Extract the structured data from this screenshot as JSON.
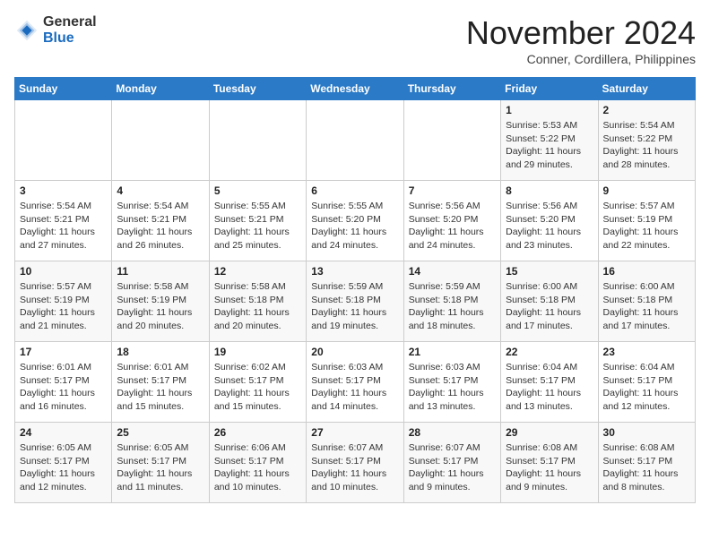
{
  "header": {
    "logo_general": "General",
    "logo_blue": "Blue",
    "month": "November 2024",
    "location": "Conner, Cordillera, Philippines"
  },
  "weekdays": [
    "Sunday",
    "Monday",
    "Tuesday",
    "Wednesday",
    "Thursday",
    "Friday",
    "Saturday"
  ],
  "weeks": [
    [
      {
        "day": "",
        "info": ""
      },
      {
        "day": "",
        "info": ""
      },
      {
        "day": "",
        "info": ""
      },
      {
        "day": "",
        "info": ""
      },
      {
        "day": "",
        "info": ""
      },
      {
        "day": "1",
        "info": "Sunrise: 5:53 AM\nSunset: 5:22 PM\nDaylight: 11 hours\nand 29 minutes."
      },
      {
        "day": "2",
        "info": "Sunrise: 5:54 AM\nSunset: 5:22 PM\nDaylight: 11 hours\nand 28 minutes."
      }
    ],
    [
      {
        "day": "3",
        "info": "Sunrise: 5:54 AM\nSunset: 5:21 PM\nDaylight: 11 hours\nand 27 minutes."
      },
      {
        "day": "4",
        "info": "Sunrise: 5:54 AM\nSunset: 5:21 PM\nDaylight: 11 hours\nand 26 minutes."
      },
      {
        "day": "5",
        "info": "Sunrise: 5:55 AM\nSunset: 5:21 PM\nDaylight: 11 hours\nand 25 minutes."
      },
      {
        "day": "6",
        "info": "Sunrise: 5:55 AM\nSunset: 5:20 PM\nDaylight: 11 hours\nand 24 minutes."
      },
      {
        "day": "7",
        "info": "Sunrise: 5:56 AM\nSunset: 5:20 PM\nDaylight: 11 hours\nand 24 minutes."
      },
      {
        "day": "8",
        "info": "Sunrise: 5:56 AM\nSunset: 5:20 PM\nDaylight: 11 hours\nand 23 minutes."
      },
      {
        "day": "9",
        "info": "Sunrise: 5:57 AM\nSunset: 5:19 PM\nDaylight: 11 hours\nand 22 minutes."
      }
    ],
    [
      {
        "day": "10",
        "info": "Sunrise: 5:57 AM\nSunset: 5:19 PM\nDaylight: 11 hours\nand 21 minutes."
      },
      {
        "day": "11",
        "info": "Sunrise: 5:58 AM\nSunset: 5:19 PM\nDaylight: 11 hours\nand 20 minutes."
      },
      {
        "day": "12",
        "info": "Sunrise: 5:58 AM\nSunset: 5:18 PM\nDaylight: 11 hours\nand 20 minutes."
      },
      {
        "day": "13",
        "info": "Sunrise: 5:59 AM\nSunset: 5:18 PM\nDaylight: 11 hours\nand 19 minutes."
      },
      {
        "day": "14",
        "info": "Sunrise: 5:59 AM\nSunset: 5:18 PM\nDaylight: 11 hours\nand 18 minutes."
      },
      {
        "day": "15",
        "info": "Sunrise: 6:00 AM\nSunset: 5:18 PM\nDaylight: 11 hours\nand 17 minutes."
      },
      {
        "day": "16",
        "info": "Sunrise: 6:00 AM\nSunset: 5:18 PM\nDaylight: 11 hours\nand 17 minutes."
      }
    ],
    [
      {
        "day": "17",
        "info": "Sunrise: 6:01 AM\nSunset: 5:17 PM\nDaylight: 11 hours\nand 16 minutes."
      },
      {
        "day": "18",
        "info": "Sunrise: 6:01 AM\nSunset: 5:17 PM\nDaylight: 11 hours\nand 15 minutes."
      },
      {
        "day": "19",
        "info": "Sunrise: 6:02 AM\nSunset: 5:17 PM\nDaylight: 11 hours\nand 15 minutes."
      },
      {
        "day": "20",
        "info": "Sunrise: 6:03 AM\nSunset: 5:17 PM\nDaylight: 11 hours\nand 14 minutes."
      },
      {
        "day": "21",
        "info": "Sunrise: 6:03 AM\nSunset: 5:17 PM\nDaylight: 11 hours\nand 13 minutes."
      },
      {
        "day": "22",
        "info": "Sunrise: 6:04 AM\nSunset: 5:17 PM\nDaylight: 11 hours\nand 13 minutes."
      },
      {
        "day": "23",
        "info": "Sunrise: 6:04 AM\nSunset: 5:17 PM\nDaylight: 11 hours\nand 12 minutes."
      }
    ],
    [
      {
        "day": "24",
        "info": "Sunrise: 6:05 AM\nSunset: 5:17 PM\nDaylight: 11 hours\nand 12 minutes."
      },
      {
        "day": "25",
        "info": "Sunrise: 6:05 AM\nSunset: 5:17 PM\nDaylight: 11 hours\nand 11 minutes."
      },
      {
        "day": "26",
        "info": "Sunrise: 6:06 AM\nSunset: 5:17 PM\nDaylight: 11 hours\nand 10 minutes."
      },
      {
        "day": "27",
        "info": "Sunrise: 6:07 AM\nSunset: 5:17 PM\nDaylight: 11 hours\nand 10 minutes."
      },
      {
        "day": "28",
        "info": "Sunrise: 6:07 AM\nSunset: 5:17 PM\nDaylight: 11 hours\nand 9 minutes."
      },
      {
        "day": "29",
        "info": "Sunrise: 6:08 AM\nSunset: 5:17 PM\nDaylight: 11 hours\nand 9 minutes."
      },
      {
        "day": "30",
        "info": "Sunrise: 6:08 AM\nSunset: 5:17 PM\nDaylight: 11 hours\nand 8 minutes."
      }
    ]
  ]
}
